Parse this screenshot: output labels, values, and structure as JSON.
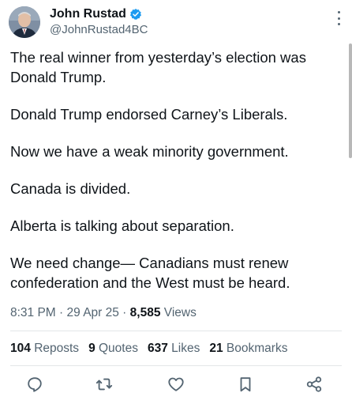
{
  "author": {
    "name": "John Rustad",
    "handle": "@JohnRustad4BC",
    "verified": true
  },
  "post": {
    "paragraphs": [
      [
        "The real winner from yesterday’s election was",
        "Donald Trump."
      ],
      [
        "Donald Trump endorsed Carney’s Liberals."
      ],
      [
        "Now we have a weak minority government."
      ],
      [
        "Canada is divided."
      ],
      [
        "Alberta is talking about separation."
      ],
      [
        "We need change— Canadians must renew",
        "confederation and the West must be heard."
      ]
    ],
    "time": "8:31 PM",
    "date": "29 Apr 25",
    "views_count": "8,585",
    "views_label": "Views"
  },
  "stats": {
    "reposts_count": "104",
    "reposts_label": "Reposts",
    "quotes_count": "9",
    "quotes_label": "Quotes",
    "likes_count": "637",
    "likes_label": "Likes",
    "bookmarks_count": "21",
    "bookmarks_label": "Bookmarks"
  },
  "actions": [
    "reply-icon",
    "repost-icon",
    "like-icon",
    "bookmark-icon",
    "share-icon"
  ],
  "colors": {
    "text": "#0f1419",
    "secondary": "#536471",
    "verified_badge": "#1d9bf0",
    "divider": "#e3e6e8"
  }
}
